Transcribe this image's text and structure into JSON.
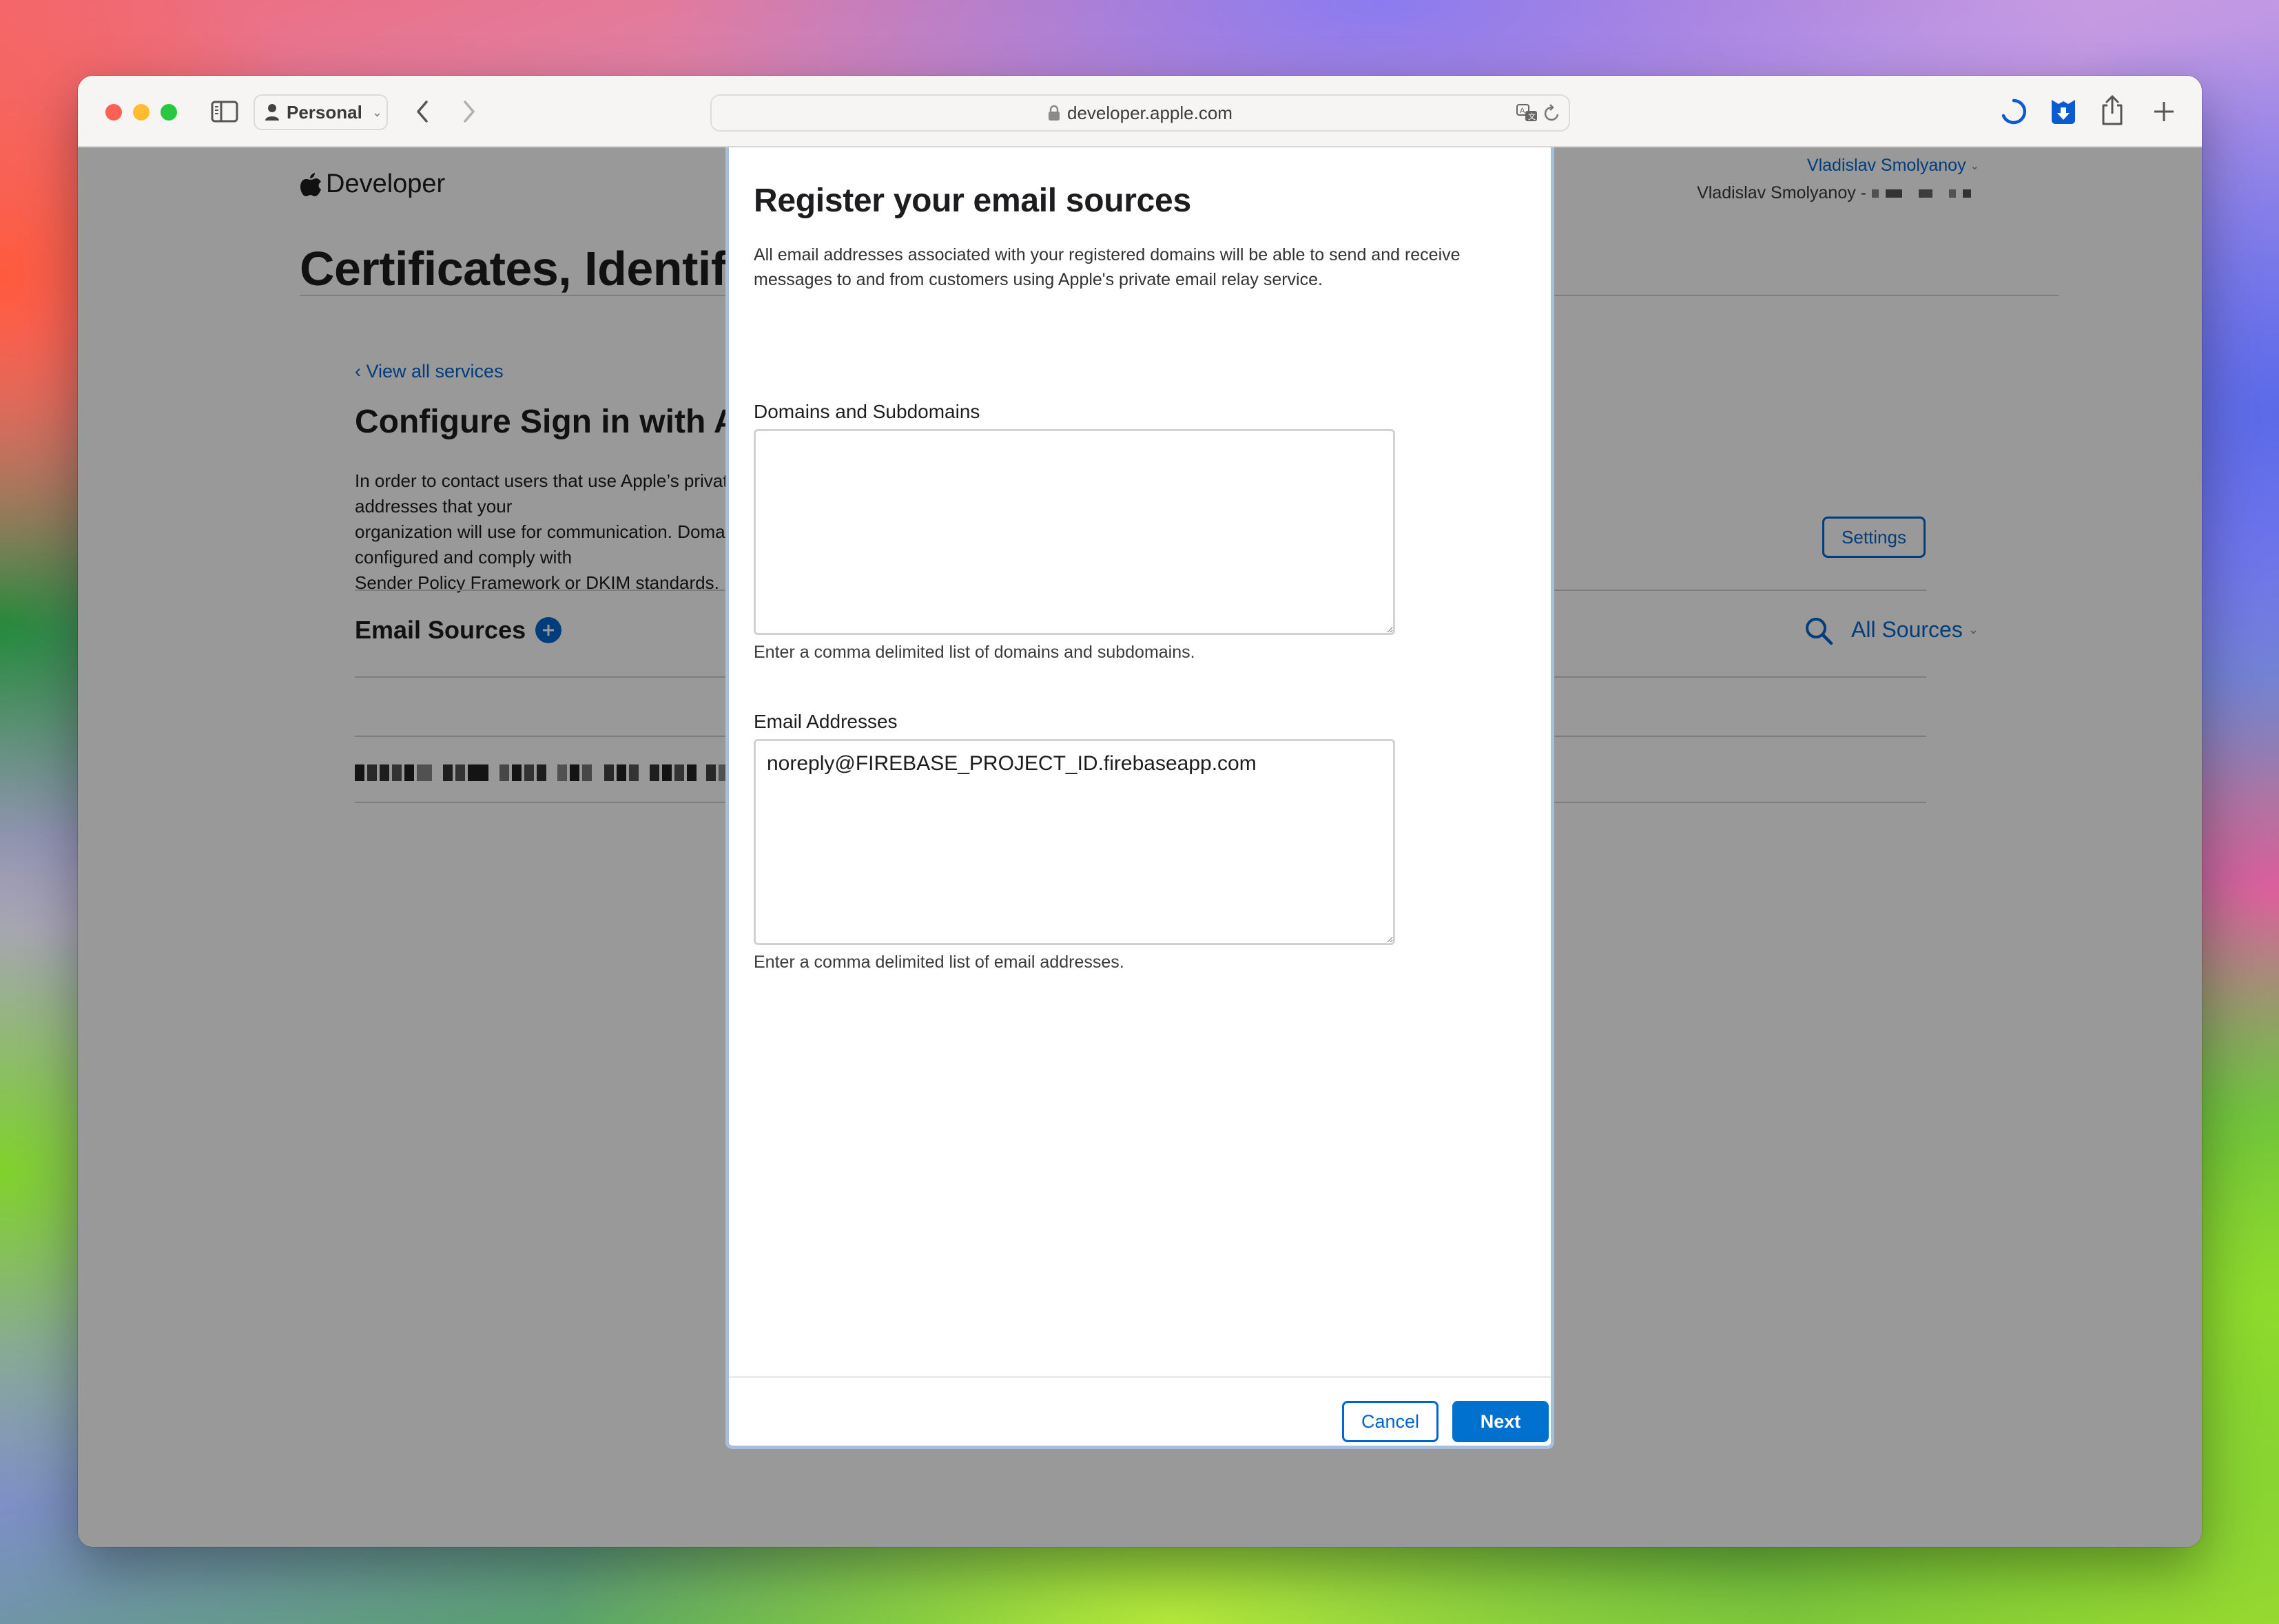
{
  "browser": {
    "profile_label": "Personal",
    "url": "developer.apple.com",
    "colors": {
      "accent": "#0066cc",
      "extension_icon": "#0a5ad0"
    }
  },
  "page": {
    "brand": "Developer",
    "user_name": "Vladislav Smolyanoy",
    "team_prefix": "Vladislav Smolyanoy -",
    "title": "Certificates, Identifiers & Profiles",
    "back_link": "View all services",
    "section_title": "Configure Sign in with Apple for Email Communication",
    "intro_lines": [
      "In order to contact users that use Apple’s private email relay service, register the domains and email addresses that your",
      "organization will use for communication. Domains must be validated to ensure that they're properly configured and comply with",
      "Sender Policy Framework or DKIM standards."
    ],
    "settings_label": "Settings",
    "email_sources_label": "Email Sources",
    "filter_label": "All Sources"
  },
  "modal": {
    "title": "Register your email sources",
    "description": "All email addresses associated with your registered domains will be able to send and receive messages to and from customers using Apple's private email relay service.",
    "domains_label": "Domains and Subdomains",
    "domains_value": "",
    "domains_hint": "Enter a comma delimited list of domains and subdomains.",
    "emails_label": "Email Addresses",
    "emails_value": "noreply@FIREBASE_PROJECT_ID.firebaseapp.com",
    "emails_hint": "Enter a comma delimited list of email addresses.",
    "cancel_label": "Cancel",
    "next_label": "Next"
  }
}
